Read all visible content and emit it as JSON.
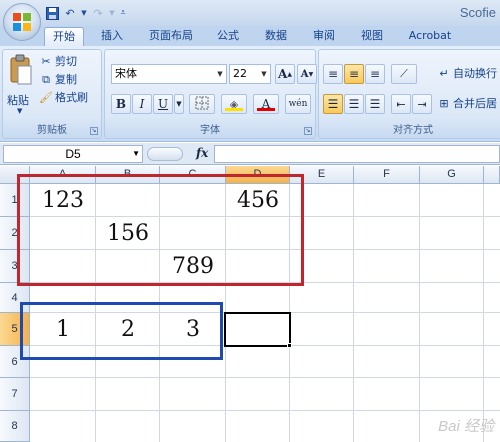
{
  "app": {
    "title": "Scofie"
  },
  "quick_access": {
    "save_icon": "save-icon",
    "undo_icon": "undo-icon",
    "redo_icon": "redo-icon",
    "customize_icon": "customize-icon"
  },
  "tabs": [
    {
      "label": "开始",
      "active": true
    },
    {
      "label": "插入"
    },
    {
      "label": "页面布局"
    },
    {
      "label": "公式"
    },
    {
      "label": "数据"
    },
    {
      "label": "审阅"
    },
    {
      "label": "视图"
    },
    {
      "label": "Acrobat"
    }
  ],
  "clipboard": {
    "group_label": "剪贴板",
    "paste_label": "粘贴",
    "cut_label": "剪切",
    "copy_label": "复制",
    "format_painter_label": "格式刷"
  },
  "font": {
    "group_label": "字体",
    "font_name": "宋体",
    "font_size": "22",
    "grow_label": "A",
    "shrink_label": "A",
    "bold_label": "B",
    "italic_label": "I",
    "underline_label": "U",
    "font_color_label": "A",
    "phonetic_label": "wén"
  },
  "alignment": {
    "group_label": "对齐方式",
    "wrap_text_label": "自动换行",
    "merge_center_label": "合并后居"
  },
  "formula_bar": {
    "name_box": "D5",
    "fx_label": "fx",
    "formula": ""
  },
  "columns": [
    "A",
    "B",
    "C",
    "D",
    "E",
    "F",
    "G"
  ],
  "active_column": "D",
  "rows": [
    "1",
    "2",
    "3",
    "4",
    "5",
    "6",
    "7",
    "8"
  ],
  "active_row": "5",
  "cells": {
    "A1": "123",
    "D1": "456",
    "B2": "156",
    "C3": "789",
    "A5": "1",
    "B5": "2",
    "C5": "3"
  },
  "colors": {
    "red_box": "#c1262e",
    "blue_box": "#1f4bb0",
    "active_header": "#f5b14c"
  },
  "watermark": "Bai 经验"
}
